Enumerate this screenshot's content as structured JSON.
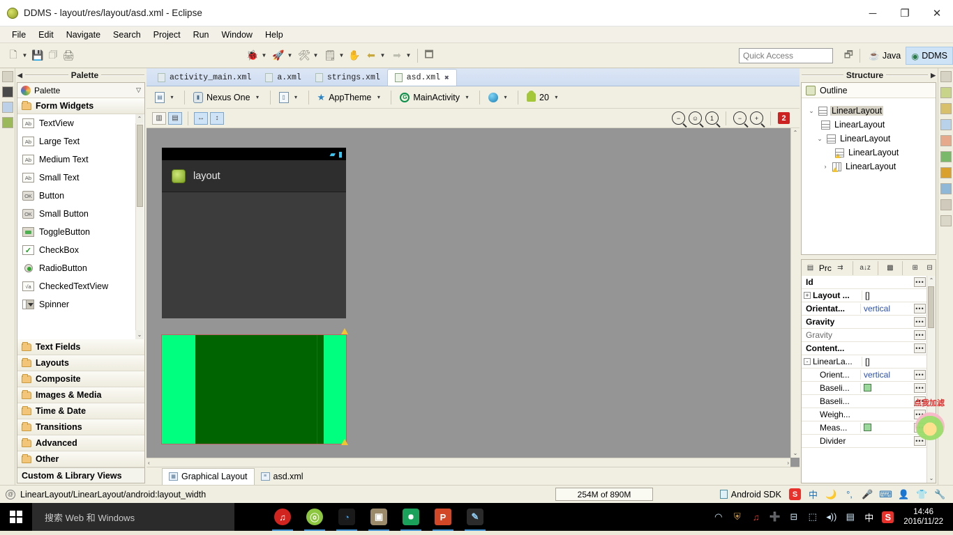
{
  "window": {
    "title": "DDMS - layout/res/layout/asd.xml - Eclipse",
    "app_icon": "eclipse-icon",
    "minimize": "─",
    "maximize": "❐",
    "close": "✕"
  },
  "menubar": {
    "items": [
      "File",
      "Edit",
      "Navigate",
      "Search",
      "Project",
      "Run",
      "Window",
      "Help"
    ]
  },
  "toolbar": {
    "quick_access_placeholder": "Quick Access",
    "perspectives": [
      {
        "label": "Java",
        "icon": "java-perspective-icon",
        "active": false
      },
      {
        "label": "DDMS",
        "icon": "ddms-perspective-icon",
        "active": true
      }
    ],
    "open_perspective_icon": "open-perspective-icon"
  },
  "palette": {
    "view_title": "Palette",
    "header_label": "Palette",
    "group": "Form Widgets",
    "widgets": [
      {
        "label": "TextView",
        "icon": "ab-icon"
      },
      {
        "label": "Large Text",
        "icon": "ab-icon"
      },
      {
        "label": "Medium Text",
        "icon": "ab-icon"
      },
      {
        "label": "Small Text",
        "icon": "ab-icon"
      },
      {
        "label": "Button",
        "icon": "ok-button-icon"
      },
      {
        "label": "Small Button",
        "icon": "ok-button-icon"
      },
      {
        "label": "ToggleButton",
        "icon": "toggle-icon"
      },
      {
        "label": "CheckBox",
        "icon": "checkbox-icon"
      },
      {
        "label": "RadioButton",
        "icon": "radio-icon"
      },
      {
        "label": "CheckedTextView",
        "icon": "checked-textview-icon"
      },
      {
        "label": "Spinner",
        "icon": "spinner-icon"
      }
    ],
    "categories": [
      "Text Fields",
      "Layouts",
      "Composite",
      "Images & Media",
      "Time & Date",
      "Transitions",
      "Advanced",
      "Other"
    ],
    "custom_views": "Custom & Library Views",
    "ab_glyph": "Ab",
    "ok_glyph": "OK",
    "va_glyph": "√a"
  },
  "editor": {
    "tabs": [
      {
        "label": "activity_main.xml",
        "active": false
      },
      {
        "label": "a.xml",
        "active": false
      },
      {
        "label": "strings.xml",
        "active": false
      },
      {
        "label": "asd.xml",
        "active": true
      }
    ],
    "close_glyph": "✖",
    "config": {
      "config_selector": "",
      "device": "Nexus One",
      "orientation": "",
      "theme": "AppTheme",
      "activity": "MainActivity",
      "locale": "",
      "api_level": "20",
      "caret": "▾"
    },
    "layout_toggles": {
      "show_included": "columns-toggle",
      "show_outline": "rows-toggle",
      "fit_width": "↔",
      "fit_height": "↕"
    },
    "zoom_controls": [
      "zoom-fit-icon",
      "zoom-actual-fit-icon",
      "zoom-100-icon",
      "zoom-out-icon",
      "zoom-in-icon"
    ],
    "zoom_100_glyph": "1",
    "error_count": "2",
    "bottom_tabs": [
      {
        "label": "Graphical Layout",
        "active": true
      },
      {
        "label": "asd.xml",
        "active": false
      }
    ]
  },
  "preview": {
    "app_title": "layout",
    "status_icons": [
      "wifi-icon",
      "battery-icon"
    ],
    "colors": {
      "outer_green": "#00ff7f",
      "inner_green": "#006400",
      "device_bg": "#3c3c3c",
      "canvas_bg": "#959595"
    }
  },
  "structure": {
    "view_title": "Structure",
    "outline_label": "Outline",
    "tree": [
      {
        "label": "LinearLayout",
        "depth": 0,
        "expanded": true,
        "selected": true,
        "warn": false,
        "vertical": false
      },
      {
        "label": "LinearLayout",
        "depth": 1,
        "expanded": null,
        "selected": false,
        "warn": false,
        "vertical": false
      },
      {
        "label": "LinearLayout",
        "depth": 1,
        "expanded": true,
        "selected": false,
        "warn": false,
        "vertical": false
      },
      {
        "label": "LinearLayout",
        "depth": 2,
        "expanded": null,
        "selected": false,
        "warn": true,
        "vertical": false
      },
      {
        "label": "LinearLayout",
        "depth": 2,
        "expanded": false,
        "selected": false,
        "warn": true,
        "vertical": true
      }
    ]
  },
  "properties": {
    "tab_label": "Prc",
    "toolbar_icons": [
      "show-advanced-icon",
      "sort-alpha-icon",
      "group-icon",
      "expand-all-icon",
      "collapse-all-icon"
    ],
    "sort_glyph": "a↓z",
    "expand_glyph": "⊞",
    "collapse_glyph": "⊟",
    "dots": "•••",
    "rows": [
      {
        "name": "Id",
        "value": "",
        "bold": true,
        "indent": false,
        "expander": "",
        "dots": true,
        "swatch": false
      },
      {
        "name": "Layout ...",
        "value": "[]",
        "bold": true,
        "indent": false,
        "expander": "+",
        "dots": false,
        "swatch": false
      },
      {
        "name": "Orientat...",
        "value": "vertical",
        "bold": true,
        "indent": false,
        "expander": "",
        "dots": true,
        "swatch": false
      },
      {
        "name": "Gravity",
        "value": "",
        "bold": true,
        "indent": false,
        "expander": "",
        "dots": true,
        "swatch": false
      },
      {
        "name": "Gravity",
        "value": "",
        "bold": false,
        "indent": false,
        "expander": "",
        "dots": true,
        "swatch": false
      },
      {
        "name": "Content...",
        "value": "",
        "bold": true,
        "indent": false,
        "expander": "",
        "dots": true,
        "swatch": false
      },
      {
        "name": "LinearLa...",
        "value": "[]",
        "bold": false,
        "indent": false,
        "expander": "-",
        "dots": false,
        "swatch": false
      },
      {
        "name": "Orient...",
        "value": "vertical",
        "bold": false,
        "indent": true,
        "expander": "",
        "dots": true,
        "swatch": false
      },
      {
        "name": "Baseli...",
        "value": "",
        "bold": false,
        "indent": true,
        "expander": "",
        "dots": true,
        "swatch": true
      },
      {
        "name": "Baseli...",
        "value": "",
        "bold": false,
        "indent": true,
        "expander": "",
        "dots": true,
        "swatch": false
      },
      {
        "name": "Weigh...",
        "value": "",
        "bold": false,
        "indent": true,
        "expander": "",
        "dots": true,
        "swatch": false
      },
      {
        "name": "Meas...",
        "value": "",
        "bold": false,
        "indent": true,
        "expander": "",
        "dots": true,
        "swatch": true
      },
      {
        "name": "Divider",
        "value": "",
        "bold": false,
        "indent": true,
        "expander": "",
        "dots": true,
        "swatch": false
      }
    ]
  },
  "statusbar": {
    "selection_path": "LinearLayout/LinearLayout/android:layout_width",
    "heap": "254M of 890M",
    "sdk": "Android SDK",
    "ime_label": "中",
    "sogou_label": "S"
  },
  "taskbar": {
    "search_placeholder": "搜索 Web 和 Windows",
    "apps": [
      {
        "name": "netease-music",
        "glyph": "♫",
        "color": "#d2241e"
      },
      {
        "name": "maxthon-browser",
        "glyph": "ⓞ",
        "color": "#8dc63f"
      },
      {
        "name": "rss-reader",
        "glyph": "◔",
        "color": "#2a7fc9"
      },
      {
        "name": "photo-viewer",
        "glyph": "▣",
        "color": "#8b7355"
      },
      {
        "name": "google-chrome",
        "glyph": "●",
        "color": "#1aa15a"
      },
      {
        "name": "powerpoint",
        "glyph": "P",
        "color": "#d24726"
      },
      {
        "name": "paint",
        "glyph": "✎",
        "color": "#3f7fbf"
      }
    ],
    "tray": [
      {
        "name": "wifi-icon",
        "glyph": "◠"
      },
      {
        "name": "security-icon",
        "glyph": "⛨"
      },
      {
        "name": "netease-tray-icon",
        "glyph": "♫"
      },
      {
        "name": "update-icon",
        "glyph": "➕"
      },
      {
        "name": "usb-icon",
        "glyph": "⊟"
      },
      {
        "name": "network-icon",
        "glyph": "⬚"
      },
      {
        "name": "volume-icon",
        "glyph": "◂))"
      },
      {
        "name": "action-center-icon",
        "glyph": "▤"
      },
      {
        "name": "ime-icon",
        "glyph": "中"
      },
      {
        "name": "sogou-icon",
        "glyph": "S"
      }
    ],
    "clock_time": "14:46",
    "clock_date": "2016/11/22"
  },
  "ad": {
    "text": "点我加滤"
  }
}
